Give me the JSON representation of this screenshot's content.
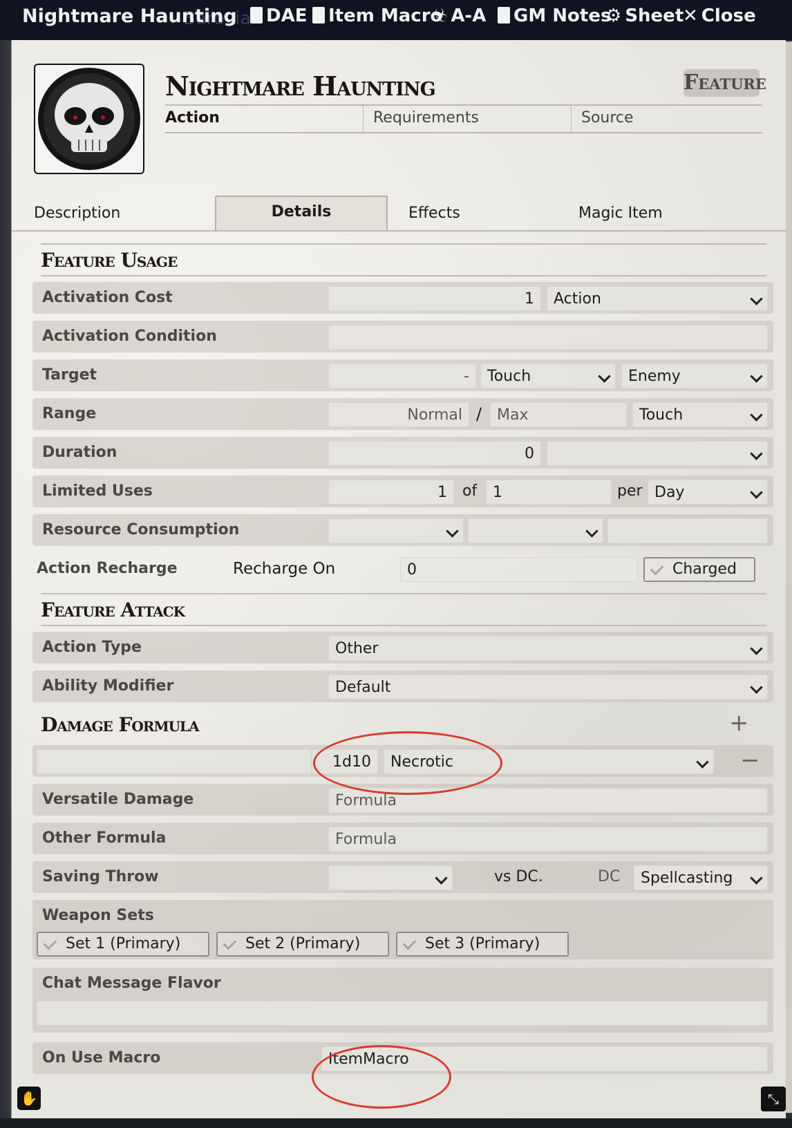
{
  "header": {
    "title": "Nightmare Haunting",
    "ghost_left": "Barovia",
    "buttons": [
      {
        "label": "DAE",
        "icon": "clipboard-icon"
      },
      {
        "label": "Item Macro",
        "icon": "sd-card-icon"
      },
      {
        "label": "A-A",
        "icon": "biohazard-icon"
      },
      {
        "label": "GM Notes",
        "icon": "clipboard-icon"
      },
      {
        "label": "Sheet",
        "icon": "gear-icon"
      },
      {
        "label": "Close",
        "icon": "close-icon"
      }
    ]
  },
  "item": {
    "name": "Nightmare Haunting",
    "type": "Feature",
    "summary": {
      "activation": "Action",
      "requirements": "Requirements",
      "source": "Source"
    }
  },
  "tabs": [
    {
      "label": "Description"
    },
    {
      "label": "Details"
    },
    {
      "label": "Effects"
    },
    {
      "label": "Magic Item"
    }
  ],
  "feature_usage": {
    "heading": "Feature Usage",
    "activation_cost": {
      "label": "Activation Cost",
      "value": "1",
      "type": "Action"
    },
    "activation_condition": {
      "label": "Activation Condition",
      "value": ""
    },
    "target": {
      "label": "Target",
      "value": "-",
      "units": "Touch",
      "type": "Enemy"
    },
    "range": {
      "label": "Range",
      "normal_placeholder": "Normal",
      "slash": "/",
      "max_placeholder": "Max",
      "units": "Touch"
    },
    "duration": {
      "label": "Duration",
      "value": "0",
      "units": ""
    },
    "limited_uses": {
      "label": "Limited Uses",
      "value": "1",
      "of": "of",
      "max": "1",
      "per": "per",
      "period": "Day"
    },
    "resource_consumption": {
      "label": "Resource Consumption"
    },
    "action_recharge": {
      "label": "Action Recharge",
      "recharge_on": "Recharge On",
      "value": "0",
      "charged": "Charged"
    }
  },
  "feature_attack": {
    "heading": "Feature Attack",
    "action_type": {
      "label": "Action Type",
      "value": "Other"
    },
    "ability_modifier": {
      "label": "Ability Modifier",
      "value": "Default"
    }
  },
  "damage": {
    "heading": "Damage Formula",
    "add_icon": "+",
    "remove_icon": "−",
    "formula": "1d10",
    "damage_type": "Necrotic",
    "versatile": {
      "label": "Versatile Damage",
      "placeholder": "Formula"
    },
    "other": {
      "label": "Other Formula",
      "placeholder": "Formula"
    },
    "saving_throw": {
      "label": "Saving Throw",
      "vs": "vs DC.",
      "dc": "DC",
      "dc_type": "Spellcasting"
    },
    "weapon_sets": {
      "label": "Weapon Sets",
      "sets": [
        "Set 1 (Primary)",
        "Set 2 (Primary)",
        "Set 3 (Primary)"
      ]
    },
    "chat_flavor": {
      "label": "Chat Message Flavor",
      "value": ""
    },
    "on_use_macro": {
      "label": "On Use Macro",
      "value": "ItemMacro"
    }
  },
  "colors": {
    "annotation": "#d63c2e",
    "header_bg": "#0f1322",
    "sheet_bg": "#e8e6e0"
  }
}
